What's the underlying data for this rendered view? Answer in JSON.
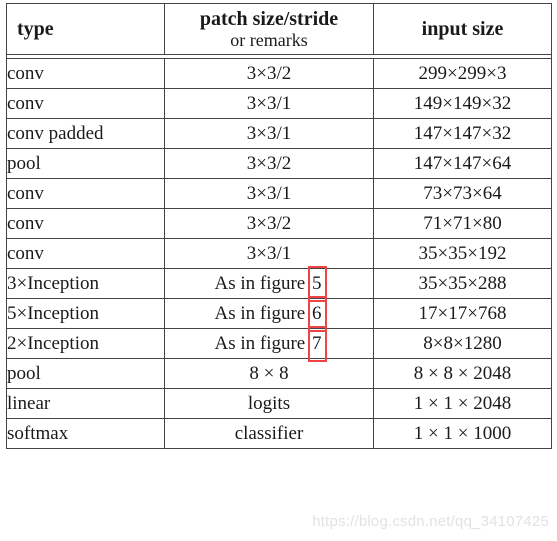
{
  "table": {
    "headers": {
      "type": "type",
      "patch_main": "patch size/stride",
      "patch_sub": "or remarks",
      "input": "input size"
    },
    "rows": [
      {
        "type": "conv",
        "patch": "3×3/2",
        "fig": "",
        "input": "299×299×3"
      },
      {
        "type": "conv",
        "patch": "3×3/1",
        "fig": "",
        "input": "149×149×32"
      },
      {
        "type": "conv padded",
        "patch": "3×3/1",
        "fig": "",
        "input": "147×147×32"
      },
      {
        "type": "pool",
        "patch": "3×3/2",
        "fig": "",
        "input": "147×147×64"
      },
      {
        "type": "conv",
        "patch": "3×3/1",
        "fig": "",
        "input": "73×73×64"
      },
      {
        "type": "conv",
        "patch": "3×3/2",
        "fig": "",
        "input": "71×71×80"
      },
      {
        "type": "conv",
        "patch": "3×3/1",
        "fig": "",
        "input": "35×35×192"
      },
      {
        "type": "3×Inception",
        "patch": "As in figure",
        "fig": "5",
        "input": "35×35×288"
      },
      {
        "type": "5×Inception",
        "patch": "As in figure",
        "fig": "6",
        "input": "17×17×768"
      },
      {
        "type": "2×Inception",
        "patch": "As in figure",
        "fig": "7",
        "input": "8×8×1280"
      },
      {
        "type": "pool",
        "patch": "8 × 8",
        "fig": "",
        "input": "8 × 8 × 2048"
      },
      {
        "type": "linear",
        "patch": "logits",
        "fig": "",
        "input": "1 × 1 × 2048"
      },
      {
        "type": "softmax",
        "patch": "classifier",
        "fig": "",
        "input": "1 × 1 × 1000"
      }
    ]
  },
  "watermark": {
    "text": "https://blog.csdn.net/qq_34107425"
  },
  "colors": {
    "highlight": "#ef4444",
    "border": "#444444",
    "text": "#1a1a1a",
    "watermark": "#e2e2e2"
  }
}
